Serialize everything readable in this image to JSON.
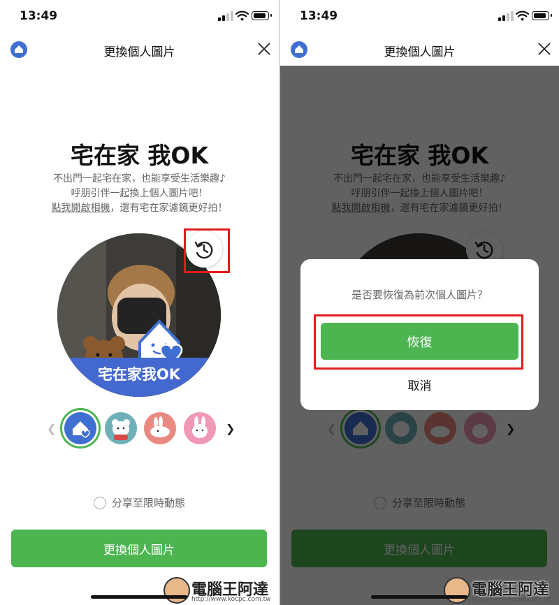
{
  "status": {
    "time": "13:49"
  },
  "header": {
    "title": "更換個人圖片"
  },
  "promo": {
    "title": "宅在家 我OK",
    "line1": "不出門一起宅在家，也能享受生活樂趣♪",
    "line2": "呼朋引伴一起換上個人圖片吧！",
    "line3_link": "點我開啟相機",
    "line3_rest": "，還有宅在家濾鏡更好拍！"
  },
  "avatar": {
    "banner_text": "宅在家我OK"
  },
  "filters": [
    {
      "icon": "house-heart-icon",
      "selected": true,
      "bg": "#3f6fd1"
    },
    {
      "icon": "bear-icon",
      "selected": false,
      "bg": "#6fb0b8"
    },
    {
      "icon": "rabbit-lying-icon",
      "selected": false,
      "bg": "#e98a82"
    },
    {
      "icon": "rabbit-icon",
      "selected": false,
      "bg": "#f098b6"
    }
  ],
  "share": {
    "label": "分享至限時動態"
  },
  "cta": {
    "label": "更換個人圖片"
  },
  "dialog": {
    "message": "是否要恢復為前次個人圖片？",
    "confirm": "恢復",
    "cancel": "取消"
  },
  "watermark": {
    "brand": "電腦王阿達",
    "url": "http://www.kocpc.com.tw"
  },
  "colors": {
    "accent": "#4cb550",
    "highlight": "#e31b1b",
    "overlay": "rgba(0,0,0,0.62)"
  }
}
